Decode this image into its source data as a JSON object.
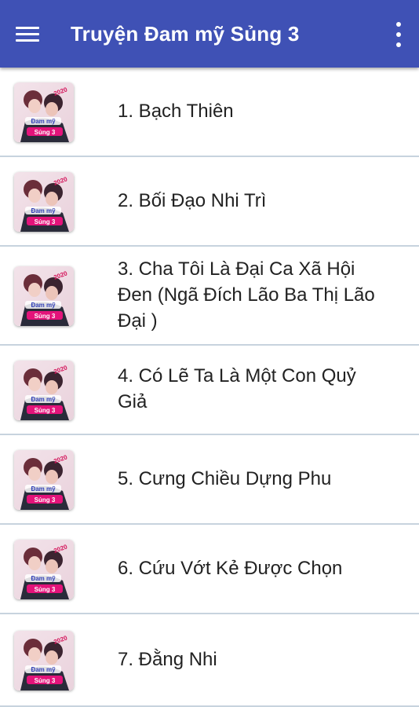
{
  "appbar": {
    "title": "Truyện Đam mỹ Sủng 3",
    "menu_icon": "hamburger-menu-icon",
    "overflow_icon": "more-vert-icon",
    "color": "#3f51b5"
  },
  "thumbnail": {
    "badge_top": "2020",
    "badge_line1": "Đam mỹ",
    "badge_line2": "Sủng 3"
  },
  "items": [
    {
      "label": "1. Bạch Thiên"
    },
    {
      "label": "2. Bối Đạo Nhi Trì"
    },
    {
      "label": "3. Cha Tôi Là Đại Ca Xã Hội Đen (Ngã Đích Lão Ba Thị Lão Đại )"
    },
    {
      "label": "4. Có Lẽ Ta Là Một Con Quỷ Giả"
    },
    {
      "label": "5. Cưng Chiều Dựng Phu"
    },
    {
      "label": "6. Cứu Vớt Kẻ Được Chọn"
    },
    {
      "label": "7. Đằng Nhi"
    }
  ]
}
